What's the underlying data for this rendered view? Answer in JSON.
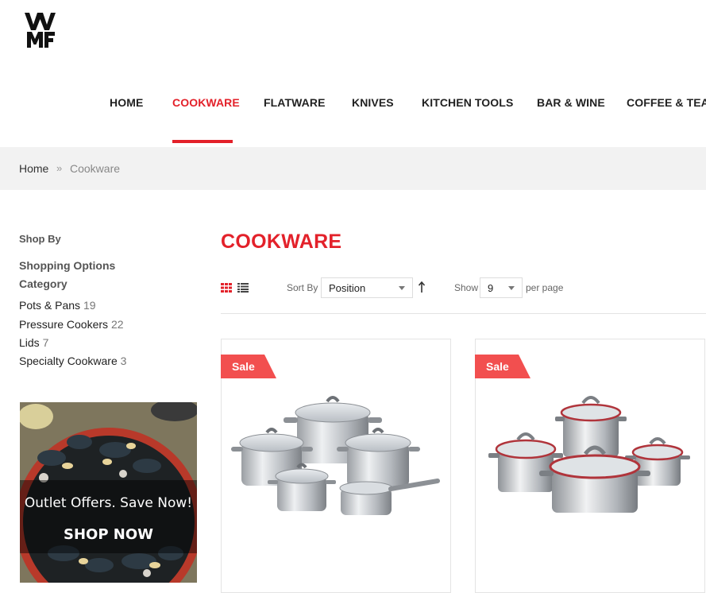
{
  "brand": {
    "logo": "WMF",
    "accent": "#e3212a"
  },
  "nav": {
    "items": [
      {
        "label": "HOME",
        "active": false
      },
      {
        "label": "COOKWARE",
        "active": true
      },
      {
        "label": "FLATWARE",
        "active": false
      },
      {
        "label": "KNIVES",
        "active": false
      },
      {
        "label": "KITCHEN TOOLS",
        "active": false
      },
      {
        "label": "BAR & WINE",
        "active": false
      },
      {
        "label": "COFFEE & TEA",
        "active": false
      }
    ]
  },
  "breadcrumb": {
    "home": "Home",
    "separator": "»",
    "current": "Cookware"
  },
  "sidebar": {
    "shop_by": "Shop By",
    "shopping_options": "Shopping Options",
    "category_heading": "Category",
    "categories": [
      {
        "label": "Pots & Pans",
        "count": "19"
      },
      {
        "label": "Pressure Cookers",
        "count": "22"
      },
      {
        "label": "Lids",
        "count": "7"
      },
      {
        "label": "Specialty Cookware",
        "count": "3"
      }
    ],
    "promo": {
      "headline": "Outlet Offers. Save Now!",
      "cta": "SHOP NOW"
    }
  },
  "main": {
    "title": "COOKWARE",
    "toolbar": {
      "sort_label": "Sort By",
      "sort_value": "Position",
      "show_label": "Show",
      "show_value": "9",
      "per_page_label": "per page",
      "view_icons": [
        "grid-icon",
        "list-icon"
      ],
      "sort_direction_icon": "arrow-up-icon"
    },
    "products": [
      {
        "badge": "Sale"
      },
      {
        "badge": "Sale"
      }
    ]
  }
}
